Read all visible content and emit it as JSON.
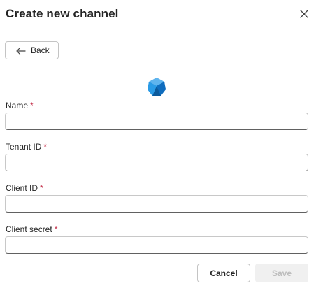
{
  "dialog": {
    "title": "Create new channel",
    "close_icon": "close-icon"
  },
  "back_button": {
    "label": "Back",
    "icon": "arrow-left-icon"
  },
  "logo_icon": "channel-logo-icon",
  "fields": {
    "name": {
      "label": "Name",
      "required_mark": "*",
      "value": ""
    },
    "tenant_id": {
      "label": "Tenant ID",
      "required_mark": "*",
      "value": ""
    },
    "client_id": {
      "label": "Client ID",
      "required_mark": "*",
      "value": ""
    },
    "client_secret": {
      "label": "Client secret",
      "required_mark": "*",
      "value": ""
    }
  },
  "actions": {
    "cancel_label": "Cancel",
    "save_label": "Save",
    "save_enabled": false
  },
  "colors": {
    "required": "#c4314b",
    "logo_primary": "#1c8ad6",
    "logo_dark": "#0b5a9c",
    "disabled_bg": "#f0f0f0",
    "disabled_text": "#bdbdbd"
  }
}
